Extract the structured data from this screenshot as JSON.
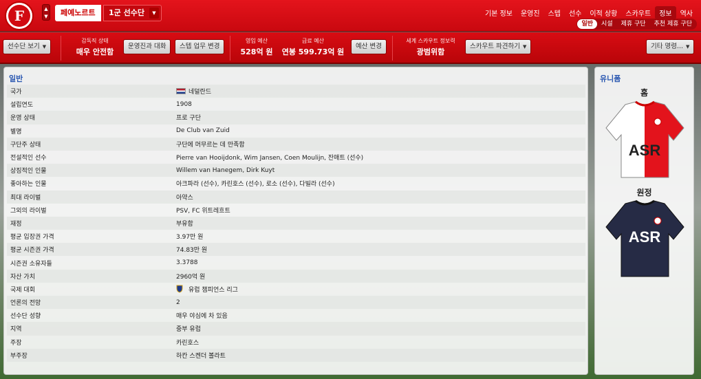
{
  "club": {
    "crest_letter": "F",
    "tab_label": "페예노르트",
    "squad_label": "1군 선수단"
  },
  "nav": {
    "top": [
      "기본 정보",
      "운영진",
      "스텝",
      "선수",
      "이적 상황",
      "스카우트",
      "정보",
      "역사"
    ],
    "active_top": "정보",
    "sub": [
      "일반",
      "시설",
      "제휴 구단",
      "추천 제휴 구단"
    ],
    "active_sub": "일반"
  },
  "toolbar": {
    "squad_view": "선수단 보기",
    "board_status_label": "감독직 상태",
    "board_status_value": "매우 안전함",
    "talk_board": "운영진과 대화",
    "change_staff": "스텝 업무 변경",
    "budget_label": "영입 예산",
    "budget_value": "528억 원",
    "wage_label": "급료 예산",
    "wage_value": "연봉 599.73억 원",
    "change_budget": "예산 변경",
    "scout_label": "세계 스카우트 정보력",
    "scout_value": "광범위함",
    "dispatch_scout": "스카우트 파견하기",
    "other": "기타 명령..."
  },
  "general": {
    "title": "일반",
    "rows": [
      {
        "k": "국가",
        "v": "네덜란드",
        "icon": "flag"
      },
      {
        "k": "설립연도",
        "v": "1908"
      },
      {
        "k": "운영 상태",
        "v": "프로 구단"
      },
      {
        "k": "별명",
        "v": "De Club van Zuid"
      },
      {
        "k": "구단주 상태",
        "v": "구단에 머무르는 데 만족함"
      },
      {
        "k": "전설적인 선수",
        "v": "Pierre van Hooijdonk, Wim Jansen, Coen Moulijn, 잔매트 (선수)"
      },
      {
        "k": "상징적인 인물",
        "v": "Willem van Hanegem, Dirk Kuyt"
      },
      {
        "k": "좋아하는 인물",
        "v": "아크파라 (선수), 카린호스 (선수), 로소 (선수), 다빌라 (선수)"
      },
      {
        "k": "최대 라이벌",
        "v": "아약스"
      },
      {
        "k": "그외의 라이벌",
        "v": "PSV, FC 위트레흐트"
      },
      {
        "k": "재정",
        "v": "부유함"
      },
      {
        "k": "평균 입장권 가격",
        "v": "3.97만 원"
      },
      {
        "k": "평균 시즌권 가격",
        "v": "74.83만 원"
      },
      {
        "k": "시즌권 소유자들",
        "v": "3.3788"
      },
      {
        "k": "자산 가치",
        "v": "2960억 원"
      },
      {
        "k": "국제 대회",
        "v": "유럽 챔피언스 리그",
        "icon": "trophy"
      },
      {
        "k": "언론의 전망",
        "v": "2"
      },
      {
        "k": "선수단 성향",
        "v": "매우 야심에 차 있음"
      },
      {
        "k": "지역",
        "v": "중부 유럽"
      },
      {
        "k": "주장",
        "v": "카린호스"
      },
      {
        "k": "부주장",
        "v": "하칸 스켄더 볼라트"
      }
    ]
  },
  "kits": {
    "title": "유니폼",
    "home": "홈",
    "away": "원정",
    "sponsor": "ASR",
    "home_colors": [
      "#e3131c",
      "#ffffff"
    ],
    "away_color": "#262b45"
  }
}
